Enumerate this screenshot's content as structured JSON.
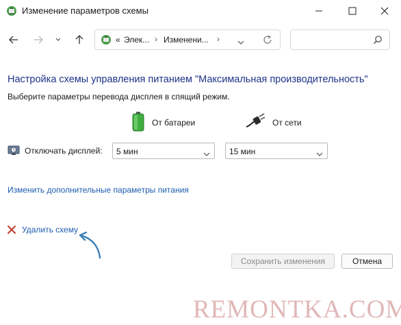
{
  "window": {
    "title": "Изменение параметров схемы"
  },
  "nav": {
    "breadcrumb": [
      "Элек...",
      "Изменени..."
    ],
    "breadcrumb_prefix": "«",
    "search_placeholder": ""
  },
  "content": {
    "heading": "Настройка схемы управления питанием \"Максимальная производительность\"",
    "subheading": "Выберите параметры перевода дисплея в спящий режим.",
    "columns": {
      "battery": "От батареи",
      "plugged": "От сети"
    },
    "display_row": {
      "label": "Отключать дисплей:",
      "battery_value": "5 мин",
      "plugged_value": "15 мин"
    },
    "advanced_link": "Изменить дополнительные параметры питания",
    "delete_link": "Удалить схему"
  },
  "buttons": {
    "save": "Сохранить изменения",
    "cancel": "Отмена"
  },
  "watermark": "REMONTKA.COM",
  "colors": {
    "heading": "#1e3287",
    "link": "#1c5bb0",
    "arrow": "#3f7fb8",
    "delete_icon": "#c0392b",
    "battery": "#3fae3f",
    "watermark": "#e1b7b7"
  }
}
